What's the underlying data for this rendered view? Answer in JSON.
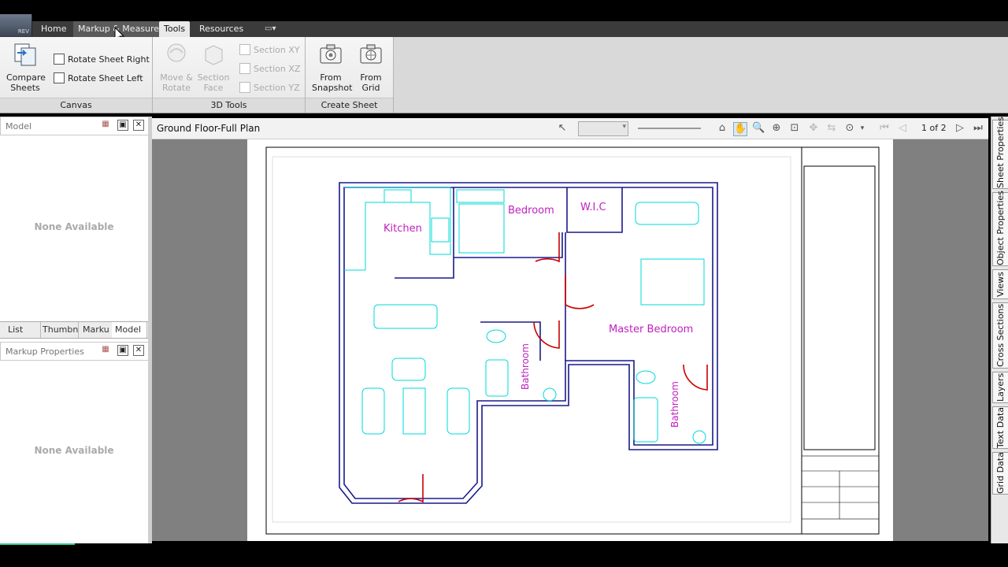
{
  "app": {
    "logo_text": "REV"
  },
  "ribbon_tabs": [
    {
      "label": "Home"
    },
    {
      "label": "Markup & Measure"
    },
    {
      "label": "Tools"
    },
    {
      "label": "Resources"
    }
  ],
  "canvas_panel": {
    "title": "Canvas",
    "compare_sheets": "Compare\nSheets",
    "rotate_right": "Rotate Sheet Right",
    "rotate_left": "Rotate Sheet Left"
  },
  "tools3d_panel": {
    "title": "3D Tools",
    "move_rotate": "Move &\nRotate",
    "section_face": "Section\nFace",
    "section_xy": "Section XY",
    "section_xz": "Section XZ",
    "section_yz": "Section YZ"
  },
  "create_sheet_panel": {
    "title": "Create Sheet",
    "from_snapshot": "From\nSnapshot",
    "from_grid": "From\nGrid"
  },
  "left_pane": {
    "model_placeholder": "Model",
    "none_available_top": "None Available",
    "tabs": [
      "List Vie",
      "Thumbn",
      "Marku",
      "Model"
    ],
    "active_tab": "Model",
    "markup_placeholder": "Markup Properties",
    "none_available_bottom": "None Available"
  },
  "view": {
    "title": "Ground Floor-Full Plan",
    "page_indicator": "1 of 2"
  },
  "floor_plan": {
    "rooms": [
      "Kitchen",
      "Bedroom",
      "W.I.C",
      "Master Bedroom",
      "Bathroom",
      "Bathroom"
    ],
    "wall_color": "#1a1a8c",
    "furniture_color": "#00d8d8",
    "door_color": "#cc0000",
    "label_color": "#c020c0"
  },
  "right_tabs": [
    "Sheet Properties",
    "Object Properties",
    "Views",
    "Cross Sections",
    "Layers",
    "Text Data",
    "Grid Data"
  ]
}
